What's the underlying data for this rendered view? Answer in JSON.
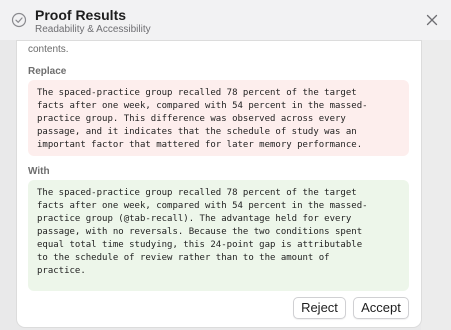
{
  "header": {
    "title": "Proof Results",
    "subtitle": "Readability & Accessibility",
    "status_icon": "check-circle-icon",
    "close_icon": "close-icon"
  },
  "suggestion": {
    "clipped_text": "contents.",
    "replace_label": "Replace",
    "replace_lines": [
      "The spaced-practice group recalled 78 percent of the target",
      "facts after one week, compared with 54 percent in the massed-",
      "practice group. This difference was observed across every",
      "passage, and it indicates that the schedule of study was an",
      "important factor that mattered for later memory performance."
    ],
    "with_label": "With",
    "with_lines": [
      "The spaced-practice group recalled 78 percent of the target",
      "facts after one week, compared with 54 percent in the massed-",
      "practice group (@tab-recall). The advantage held for every",
      "passage, with no reversals. Because the two conditions spent",
      "equal total time studying, this 24-point gap is attributable",
      "to the schedule of review rather than to the amount of",
      "practice."
    ],
    "reject_label": "Reject",
    "accept_label": "Accept"
  },
  "colors": {
    "removed_bg": "#fdeeed",
    "added_bg": "#edf6ea"
  }
}
